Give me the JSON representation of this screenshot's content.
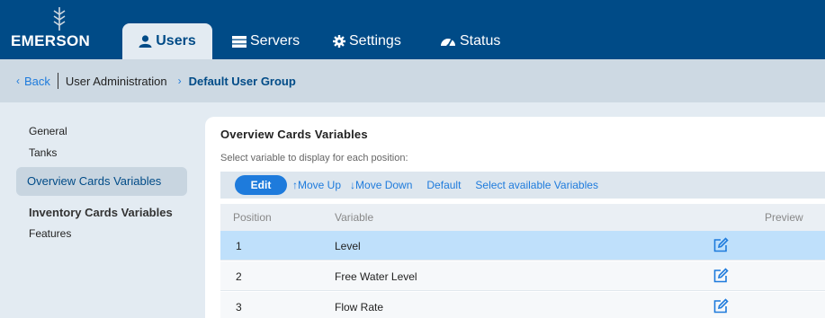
{
  "brand": {
    "name": "EMERSON",
    "color": "#004b87",
    "logo_icon": "emerson-mark-icon"
  },
  "nav": {
    "tabs": [
      {
        "label": "Users",
        "icon": "user-icon",
        "active": true
      },
      {
        "label": "Servers",
        "icon": "servers-icon",
        "active": false
      },
      {
        "label": "Settings",
        "icon": "gear-icon",
        "active": false
      },
      {
        "label": "Status",
        "icon": "status-icon",
        "active": false
      }
    ]
  },
  "breadcrumb": {
    "back_label": "Back",
    "parent": "User Administration",
    "current": "Default User Group"
  },
  "sidebar": {
    "items": [
      {
        "label": "General"
      },
      {
        "label": "Tanks"
      },
      {
        "label": "Overview Cards Variables",
        "active": true
      },
      {
        "label": "Inventory Cards Variables"
      },
      {
        "label": "Features"
      }
    ]
  },
  "card": {
    "title": "Overview Cards Variables",
    "subtitle": "Select variable to display for each position:"
  },
  "toolbar": {
    "edit_label": "Edit",
    "move_up_label": "Move Up",
    "move_down_label": "Move Down",
    "default_label": "Default",
    "select_label": "Select available Variables"
  },
  "table": {
    "headers": {
      "position": "Position",
      "variable": "Variable",
      "preview": "Preview"
    },
    "rows": [
      {
        "position": "1",
        "variable": "Level",
        "selected": true
      },
      {
        "position": "2",
        "variable": "Free Water Level",
        "selected": false
      },
      {
        "position": "3",
        "variable": "Flow Rate",
        "selected": false
      }
    ]
  },
  "colors": {
    "accent": "#1e7bdc",
    "nav_bg": "#004b87",
    "selected_row": "#bfe0fb"
  }
}
